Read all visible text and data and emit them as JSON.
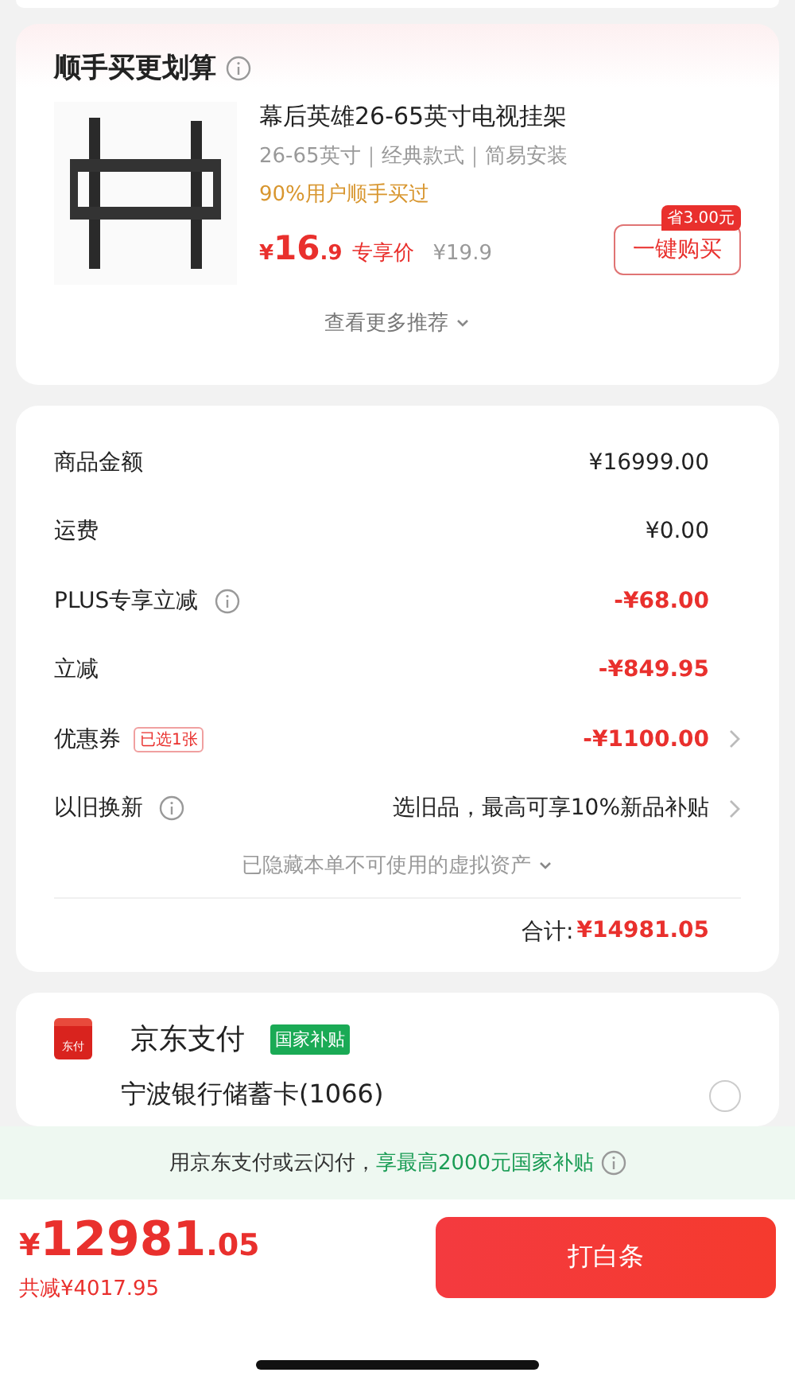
{
  "addon": {
    "title": "顺手买更划算",
    "product": {
      "name": "幕后英雄26-65英寸电视挂架",
      "specs": "26-65英寸｜经典款式｜简易安装",
      "social": "90%用户顺手买过",
      "currency": "¥",
      "price_int": "16",
      "price_dec": ".9",
      "price_label": "专享价",
      "original_price": "¥19.9",
      "save_badge": "省3.00元",
      "buy_button": "一键购买"
    },
    "more": "查看更多推荐"
  },
  "summary": {
    "rows": [
      {
        "label": "商品金额",
        "value": "¥16999.00",
        "discount": false,
        "info": false,
        "arrow": false
      },
      {
        "label": "运费",
        "value": "¥0.00",
        "discount": false,
        "info": false,
        "arrow": false
      },
      {
        "label": "PLUS专享立减",
        "value": "-¥68.00",
        "discount": true,
        "info": true,
        "arrow": false
      },
      {
        "label": "立减",
        "value": "-¥849.95",
        "discount": true,
        "info": false,
        "arrow": false
      },
      {
        "label": "优惠券",
        "tag": "已选1张",
        "value": "-¥1100.00",
        "discount": true,
        "info": false,
        "arrow": true
      },
      {
        "label": "以旧换新",
        "value": "选旧品，最高可享10%新品补贴",
        "discount": false,
        "info": true,
        "arrow": true
      }
    ],
    "hidden_assets": "已隐藏本单不可使用的虚拟资产",
    "total_label": "合计:",
    "total_value": "¥14981.05"
  },
  "payment": {
    "logo_text": "东付",
    "title": "京东支付",
    "badge": "国家补贴",
    "methods": [
      {
        "name": "宁波银行储蓄卡(1066)",
        "selected": false
      }
    ]
  },
  "banner": {
    "text": "用京东支付或云闪付，",
    "highlight": "享最高2000元国家补贴"
  },
  "footer": {
    "currency": "¥",
    "amount_int": "12981",
    "amount_dec": ".05",
    "saved": "共减¥4017.95",
    "pay_button": "打白条"
  }
}
